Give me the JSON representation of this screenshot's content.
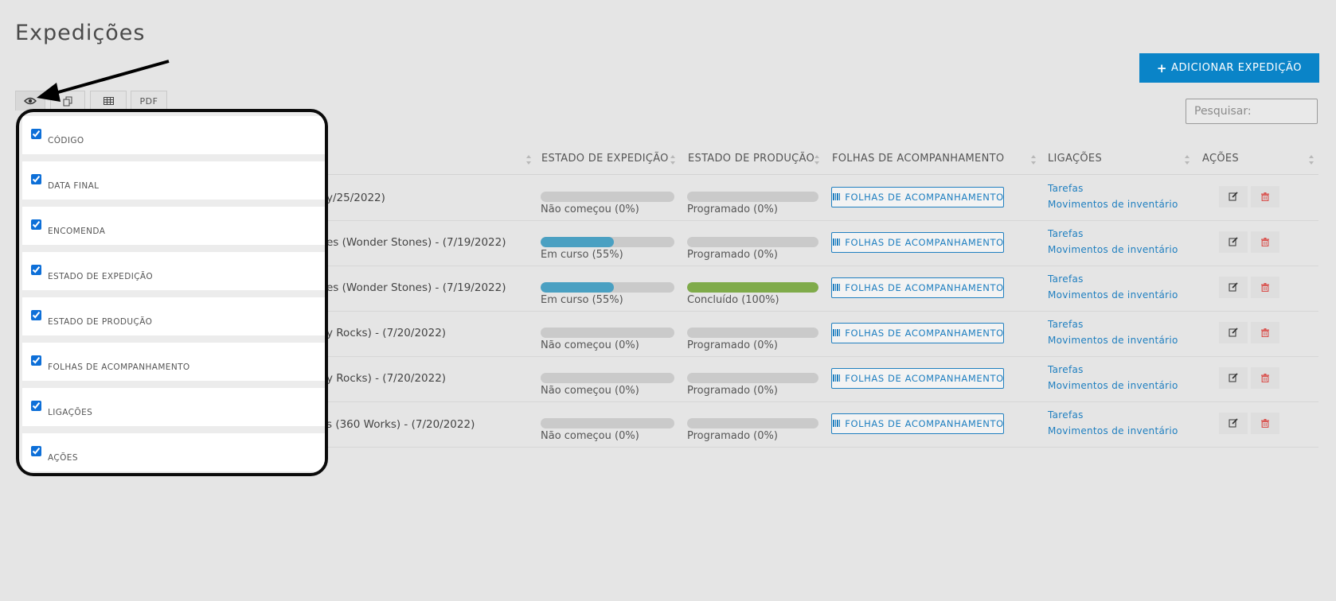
{
  "page": {
    "title": "Expedições"
  },
  "actions": {
    "add_label": "ADICIONAR EXPEDIÇÃO"
  },
  "search": {
    "placeholder": "Pesquisar:"
  },
  "toolbar": {
    "pdf_label": "PDF"
  },
  "column_menu": {
    "items": [
      {
        "label": "CÓDIGO",
        "checked": true
      },
      {
        "label": "DATA FINAL",
        "checked": true
      },
      {
        "label": "ENCOMENDA",
        "checked": true
      },
      {
        "label": "ESTADO DE EXPEDIÇÃO",
        "checked": true
      },
      {
        "label": "ESTADO DE PRODUÇÃO",
        "checked": true
      },
      {
        "label": "FOLHAS DE ACOMPANHAMENTO",
        "checked": true
      },
      {
        "label": "LIGAÇÕES",
        "checked": true
      },
      {
        "label": "AÇÕES",
        "checked": true
      }
    ]
  },
  "table": {
    "headers": {
      "shipping_state": "ESTADO DE EXPEDIÇÃO",
      "production_state": "ESTADO DE PRODUÇÃO",
      "sheets": "FOLHAS DE ACOMPANHAMENTO",
      "links": "LIGAÇÕES",
      "actions": "AÇÕES"
    },
    "sheets_button_label": "FOLHAS DE ACOMPANHAMENTO",
    "link_tasks": "Tarefas",
    "link_inventory": "Movimentos de inventário",
    "rows": [
      {
        "order": "y/25/2022)",
        "ship_label": "Não começou (0%)",
        "ship_pct": 0,
        "prod_label": "Programado (0%)",
        "prod_pct": 0
      },
      {
        "order": "es (Wonder Stones) - (7/19/2022)",
        "ship_label": "Em curso (55%)",
        "ship_pct": 55,
        "prod_label": "Programado (0%)",
        "prod_pct": 0
      },
      {
        "order": "es (Wonder Stones) - (7/19/2022)",
        "ship_label": "Em curso (55%)",
        "ship_pct": 55,
        "prod_label": "Concluído (100%)",
        "prod_pct": 100
      },
      {
        "order": "y Rocks) - (7/20/2022)",
        "ship_label": "Não começou (0%)",
        "ship_pct": 0,
        "prod_label": "Programado (0%)",
        "prod_pct": 0
      },
      {
        "order": "y Rocks) - (7/20/2022)",
        "ship_label": "Não começou (0%)",
        "ship_pct": 0,
        "prod_label": "Programado (0%)",
        "prod_pct": 0
      },
      {
        "order": "s (360 Works) - (7/20/2022)",
        "ship_label": "Não começou (0%)",
        "ship_pct": 0,
        "prod_label": "Programado (0%)",
        "prod_pct": 0
      }
    ]
  },
  "colors": {
    "primary": "#0a84c8",
    "progress_in_progress": "#4aa0c2",
    "progress_done": "#7fab4a",
    "progress_track": "#cacaca",
    "link": "#1f7fc0",
    "delete": "#d9534f"
  },
  "icons": {
    "visibility_toggle": "eye-icon",
    "copy": "copy-icon",
    "excel": "table-icon",
    "sheets": "barcode-icon",
    "edit": "edit-icon",
    "delete": "trash-icon",
    "add": "plus-icon",
    "callout": "arrow-annotation"
  }
}
